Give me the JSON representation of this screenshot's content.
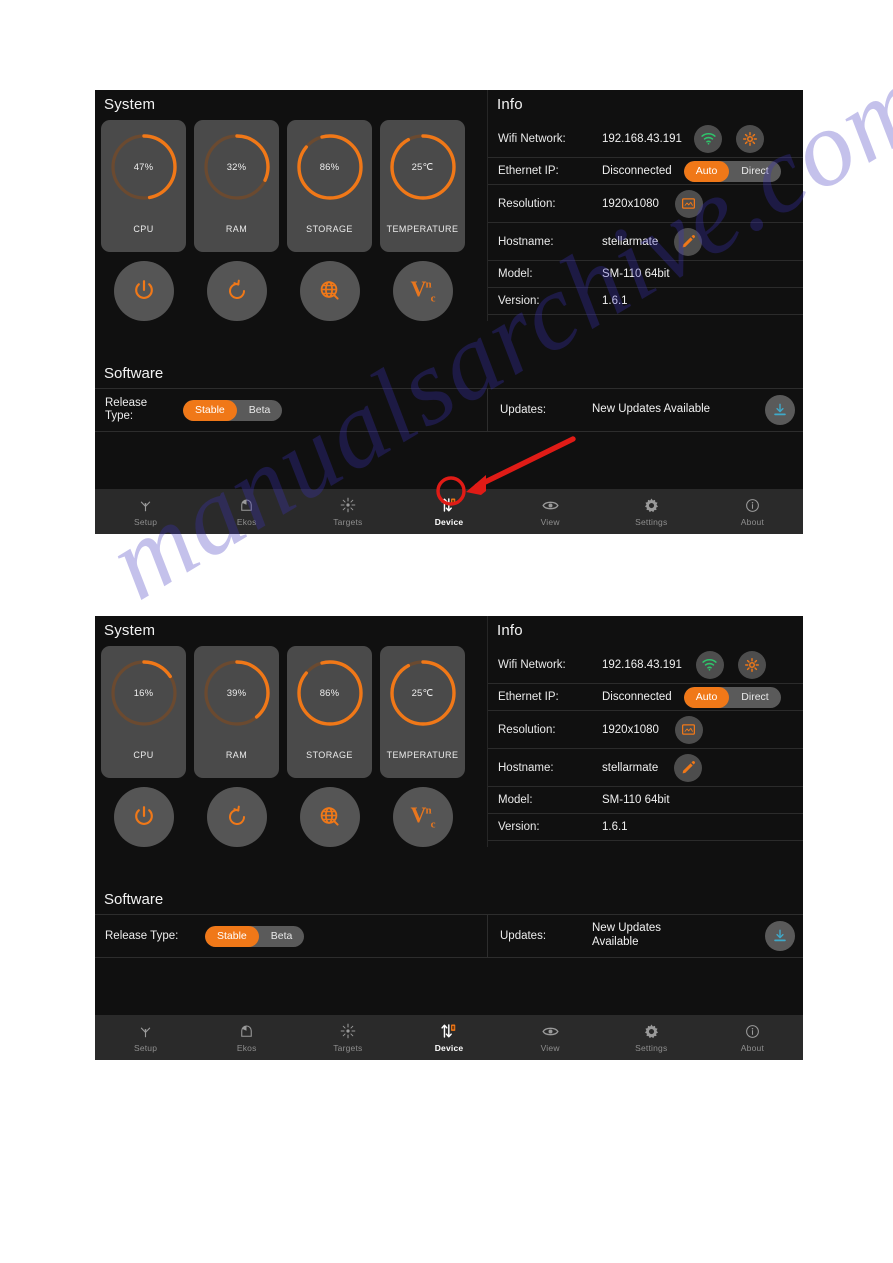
{
  "watermark": {
    "text": "manualsarchive.com"
  },
  "screens": [
    {
      "id": "screen-top",
      "system": {
        "title": "System",
        "cards": [
          {
            "label": "CPU",
            "value": "47%",
            "percent": 47
          },
          {
            "label": "RAM",
            "value": "32%",
            "percent": 32
          },
          {
            "label": "STORAGE",
            "value": "86%",
            "percent": 86
          },
          {
            "label": "TEMPERATURE",
            "value": "25℃",
            "percent": 92
          }
        ],
        "actions": [
          {
            "name": "power-button",
            "icon": "power-icon"
          },
          {
            "name": "restart-button",
            "icon": "restart-icon"
          },
          {
            "name": "web-button",
            "icon": "globe-icon"
          },
          {
            "name": "vnc-button",
            "icon": "vnc-icon",
            "label": "VNC"
          }
        ]
      },
      "info": {
        "title": "Info",
        "rows": [
          {
            "label": "Wifi Network:",
            "value": "192.168.43.191",
            "icons": [
              "wifi-icon",
              "settings-gear-icon"
            ]
          },
          {
            "label": "Ethernet IP:",
            "value": "Disconnected",
            "toggle": {
              "options": [
                "Auto",
                "Direct"
              ],
              "selected": "Auto"
            }
          },
          {
            "label": "Resolution:",
            "value": "1920x1080",
            "icons": [
              "display-icon"
            ]
          },
          {
            "label": "Hostname:",
            "value": "stellarmate",
            "icons": [
              "pencil-icon"
            ]
          },
          {
            "label": "Model:",
            "value": "SM-110 64bit",
            "icons": []
          },
          {
            "label": "Version:",
            "value": "1.6.1",
            "icons": []
          }
        ]
      },
      "software": {
        "title": "Software",
        "release_label": "Release Type:",
        "release_label_lines": [
          "Release",
          "Type:"
        ],
        "release_toggle": {
          "options": [
            "Stable",
            "Beta"
          ],
          "selected": "Stable"
        },
        "updates_label": "Updates:",
        "updates_value": "New Updates Available",
        "updates_value_lines": [
          "New Updates Available"
        ],
        "download_icon": "download-icon"
      },
      "nav": {
        "items": [
          {
            "label": "Setup",
            "icon": "setup-icon",
            "active": false
          },
          {
            "label": "Ekos",
            "icon": "ekos-dome-icon",
            "active": false
          },
          {
            "label": "Targets",
            "icon": "star-burst-icon",
            "active": false
          },
          {
            "label": "Device",
            "icon": "device-transfer-icon",
            "active": true
          },
          {
            "label": "View",
            "icon": "eye-icon",
            "active": false
          },
          {
            "label": "Settings",
            "icon": "gear-icon",
            "active": false
          },
          {
            "label": "About",
            "icon": "info-circle-icon",
            "active": false
          }
        ]
      },
      "annotation": {
        "arrow_color": "#e01b16",
        "highlight_target": "Device"
      }
    },
    {
      "id": "screen-bottom",
      "system": {
        "title": "System",
        "cards": [
          {
            "label": "CPU",
            "value": "16%",
            "percent": 16
          },
          {
            "label": "RAM",
            "value": "39%",
            "percent": 39
          },
          {
            "label": "STORAGE",
            "value": "86%",
            "percent": 86
          },
          {
            "label": "TEMPERATURE",
            "value": "25℃",
            "percent": 92
          }
        ],
        "actions": [
          {
            "name": "power-button",
            "icon": "power-icon"
          },
          {
            "name": "restart-button",
            "icon": "restart-icon"
          },
          {
            "name": "web-button",
            "icon": "globe-icon"
          },
          {
            "name": "vnc-button",
            "icon": "vnc-icon",
            "label": "VNC"
          }
        ]
      },
      "info": {
        "title": "Info",
        "rows": [
          {
            "label": "Wifi Network:",
            "value": "192.168.43.191",
            "icons": [
              "wifi-icon",
              "settings-gear-icon"
            ]
          },
          {
            "label": "Ethernet IP:",
            "value": "Disconnected",
            "toggle": {
              "options": [
                "Auto",
                "Direct"
              ],
              "selected": "Auto"
            }
          },
          {
            "label": "Resolution:",
            "value": "1920x1080",
            "icons": [
              "display-icon"
            ]
          },
          {
            "label": "Hostname:",
            "value": "stellarmate",
            "icons": [
              "pencil-icon"
            ]
          },
          {
            "label": "Model:",
            "value": "SM-110 64bit",
            "icons": []
          },
          {
            "label": "Version:",
            "value": "1.6.1",
            "icons": []
          }
        ]
      },
      "software": {
        "title": "Software",
        "release_label": "Release Type:",
        "release_toggle": {
          "options": [
            "Stable",
            "Beta"
          ],
          "selected": "Stable"
        },
        "updates_label": "Updates:",
        "updates_value_lines": [
          "New Updates",
          "Available"
        ],
        "download_icon": "download-icon"
      },
      "nav": {
        "items": [
          {
            "label": "Setup",
            "icon": "setup-icon",
            "active": false
          },
          {
            "label": "Ekos",
            "icon": "ekos-dome-icon",
            "active": false
          },
          {
            "label": "Targets",
            "icon": "star-burst-icon",
            "active": false
          },
          {
            "label": "Device",
            "icon": "device-transfer-icon",
            "active": true
          },
          {
            "label": "View",
            "icon": "eye-icon",
            "active": false
          },
          {
            "label": "Settings",
            "icon": "gear-icon",
            "active": false
          },
          {
            "label": "About",
            "icon": "info-circle-icon",
            "active": false
          }
        ]
      },
      "annotation": null
    }
  ],
  "colors": {
    "accent": "#f07818",
    "gauge_track": "#6b4a30",
    "panel": "#101010",
    "card": "#4a4a4a",
    "navbar": "#2a2a2a",
    "wifi_green": "#2fc46b",
    "arrow_red": "#e01b16",
    "download_blue": "#3fa9c9"
  }
}
